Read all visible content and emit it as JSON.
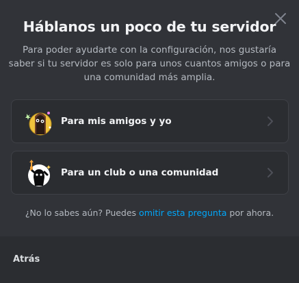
{
  "dialog": {
    "title": "Háblanos un poco de tu servidor",
    "subtitle": "Para poder ayudarte con la configuración, nos gustaría saber si tu servidor es solo para unos cuantos amigos o para una comunidad más amplia.",
    "close_icon": "close-icon"
  },
  "options": [
    {
      "label": "Para mis amigos y yo",
      "icon": "friends-illustration-icon"
    },
    {
      "label": "Para un club o una comunidad",
      "icon": "community-illustration-icon"
    }
  ],
  "hint": {
    "prefix": "¿No lo sabes aún? Puedes ",
    "link": "omitir esta pregunta",
    "suffix": " por ahora."
  },
  "footer": {
    "back_label": "Atrás"
  },
  "colors": {
    "background": "#313338",
    "card": "#2b2d31",
    "link": "#00a8fc",
    "heading": "#f2f3f5",
    "muted": "#b5bac1"
  }
}
